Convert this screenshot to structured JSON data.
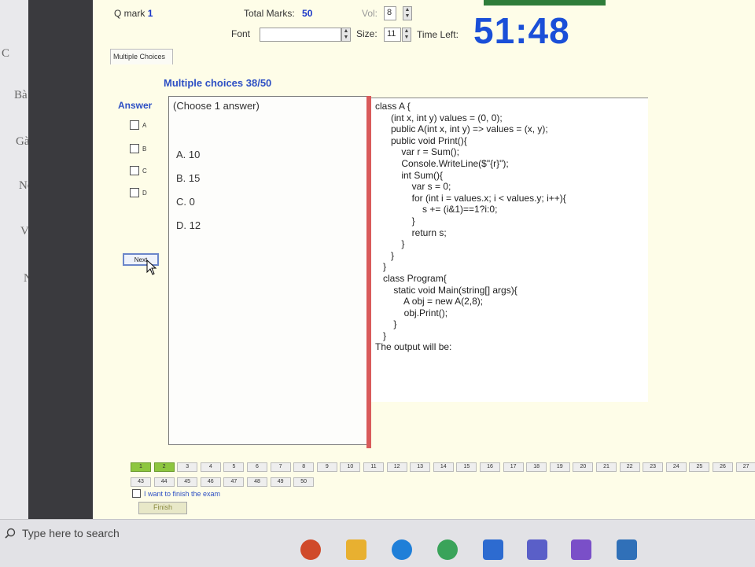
{
  "header": {
    "q_mark_label": "Q mark",
    "q_mark_value": "1",
    "total_marks_label": "Total Marks:",
    "total_marks_value": "50",
    "vol_label": "Vol:",
    "vol_value": "8",
    "font_label": "Font",
    "font_value": "",
    "size_label": "Size:",
    "size_value": "11",
    "time_left_label": "Time Left:",
    "time_left_value": "51:48"
  },
  "tab_label": "Multiple Choices",
  "question_title": "Multiple choices 38/50",
  "answer_label": "Answer",
  "answer_checkboxes": [
    "A",
    "B",
    "C",
    "D"
  ],
  "next_label": "Next",
  "choose_text": "(Choose 1 answer)",
  "options": [
    "A. 10",
    "B. 15",
    "C. 0",
    "D. 12"
  ],
  "code_text": "class A {\n      (int x, int y) values = (0, 0);\n      public A(int x, int y) => values = (x, y);\n      public void Print(){\n          var r = Sum();\n          Console.WriteLine($\"{r}\");\n          int Sum(){\n              var s = 0;\n              for (int i = values.x; i < values.y; i++){\n                  s += (i&1)==1?i:0;\n              }\n              return s;\n          }\n      }\n   }\n   class Program{\n       static void Main(string[] args){\n           A obj = new A(2,8);\n           obj.Print();\n       }\n   }\nThe output will be:",
  "question_numbers": {
    "row1": [
      "1",
      "2",
      "3",
      "4",
      "5",
      "6",
      "7",
      "8",
      "9",
      "10",
      "11",
      "12",
      "13",
      "14",
      "15",
      "16",
      "17",
      "18",
      "19",
      "20",
      "21",
      "22",
      "23",
      "24",
      "25",
      "26",
      "27"
    ],
    "row2": [
      "43",
      "44",
      "45",
      "46",
      "47",
      "48",
      "49",
      "50"
    ],
    "answered": [
      "1",
      "2"
    ]
  },
  "finish_checkbox_label": "I want to finish the exam",
  "finish_button_label": "Finish",
  "taskbar": {
    "search_placeholder": "Type here to search"
  },
  "left_edge_fragments": [
    "C",
    "Bà",
    "Gà",
    "Nọ",
    "Vi",
    "Nọ"
  ]
}
